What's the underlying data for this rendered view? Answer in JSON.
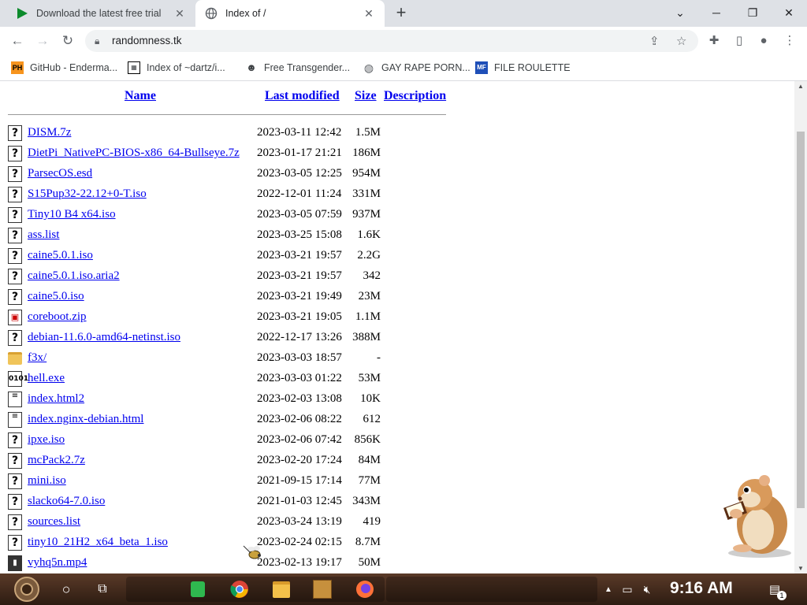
{
  "browser": {
    "tabs": [
      {
        "title": "Download the latest free trial"
      },
      {
        "title": "Index of /"
      }
    ],
    "url": "randomness.tk",
    "bookmarks": [
      {
        "label": "GitHub - Enderma...",
        "icon": "PH"
      },
      {
        "label": "Index of ~dartz/i...",
        "icon": "qr"
      },
      {
        "label": "Free Transgender...",
        "icon": "mask"
      },
      {
        "label": "GAY RAPE PORN...",
        "icon": "globe"
      },
      {
        "label": "FILE ROULETTE",
        "icon": "MF"
      }
    ]
  },
  "listing": {
    "headers": {
      "name": "Name",
      "last_modified": "Last modified",
      "size": "Size",
      "description": "Description"
    },
    "rows": [
      {
        "name": "DISM.7z",
        "date": "2023-03-11 12:42",
        "size": "1.5M",
        "icon": "unknown"
      },
      {
        "name": "DietPi_NativePC-BIOS-x86_64-Bullseye.7z",
        "date": "2023-01-17 21:21",
        "size": "186M",
        "icon": "unknown"
      },
      {
        "name": "ParsecOS.esd",
        "date": "2023-03-05 12:25",
        "size": "954M",
        "icon": "unknown"
      },
      {
        "name": "S15Pup32-22.12+0-T.iso",
        "date": "2022-12-01 11:24",
        "size": "331M",
        "icon": "unknown"
      },
      {
        "name": "Tiny10 B4 x64.iso",
        "date": "2023-03-05 07:59",
        "size": "937M",
        "icon": "unknown"
      },
      {
        "name": "ass.list",
        "date": "2023-03-25 15:08",
        "size": "1.6K",
        "icon": "unknown"
      },
      {
        "name": "caine5.0.1.iso",
        "date": "2023-03-21 19:57",
        "size": "2.2G",
        "icon": "unknown"
      },
      {
        "name": "caine5.0.1.iso.aria2",
        "date": "2023-03-21 19:57",
        "size": "342",
        "icon": "unknown"
      },
      {
        "name": "caine5.0.iso",
        "date": "2023-03-21 19:49",
        "size": "23M",
        "icon": "unknown"
      },
      {
        "name": "coreboot.zip",
        "date": "2023-03-21 19:05",
        "size": "1.1M",
        "icon": "zip"
      },
      {
        "name": "debian-11.6.0-amd64-netinst.iso",
        "date": "2022-12-17 13:26",
        "size": "388M",
        "icon": "unknown"
      },
      {
        "name": "f3x/",
        "date": "2023-03-03 18:57",
        "size": "-",
        "icon": "folder"
      },
      {
        "name": "hell.exe",
        "date": "2023-03-03 01:22",
        "size": "53M",
        "icon": "binary"
      },
      {
        "name": "index.html2",
        "date": "2023-02-03 13:08",
        "size": "10K",
        "icon": "text"
      },
      {
        "name": "index.nginx-debian.html",
        "date": "2023-02-06 08:22",
        "size": "612",
        "icon": "text"
      },
      {
        "name": "ipxe.iso",
        "date": "2023-02-06 07:42",
        "size": "856K",
        "icon": "unknown"
      },
      {
        "name": "mcPack2.7z",
        "date": "2023-02-20 17:24",
        "size": "84M",
        "icon": "unknown"
      },
      {
        "name": "mini.iso",
        "date": "2021-09-15 17:14",
        "size": "77M",
        "icon": "unknown"
      },
      {
        "name": "slacko64-7.0.iso",
        "date": "2021-01-03 12:45",
        "size": "343M",
        "icon": "unknown"
      },
      {
        "name": "sources.list",
        "date": "2023-03-24 13:19",
        "size": "419",
        "icon": "unknown"
      },
      {
        "name": "tiny10_21H2_x64_beta_1.iso",
        "date": "2023-02-24 02:15",
        "size": "8.7M",
        "icon": "unknown"
      },
      {
        "name": "vyhq5n.mp4",
        "date": "2023-02-13 19:17",
        "size": "50M",
        "icon": "video"
      }
    ]
  },
  "taskbar": {
    "clock": "9:16 AM",
    "notification_count": "1"
  }
}
